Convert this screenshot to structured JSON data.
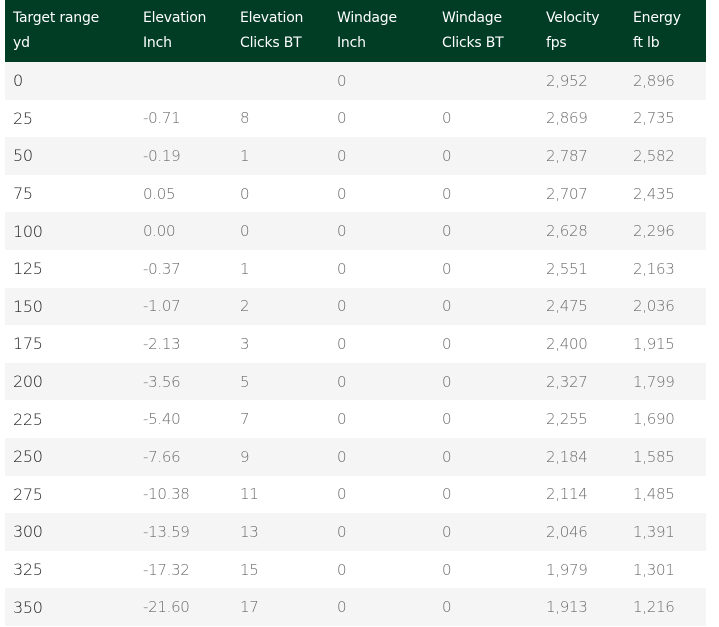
{
  "table": {
    "headers": [
      {
        "line1": "Target range",
        "line2": "yd"
      },
      {
        "line1": "Elevation",
        "line2": "Inch"
      },
      {
        "line1": "Elevation",
        "line2": "Clicks BT"
      },
      {
        "line1": "Windage",
        "line2": "Inch"
      },
      {
        "line1": "Windage",
        "line2": "Clicks BT"
      },
      {
        "line1": "Velocity",
        "line2": "fps"
      },
      {
        "line1": "Energy",
        "line2": "ft lb"
      }
    ],
    "rows": [
      [
        "0",
        "",
        "",
        "0",
        "",
        "2,952",
        "2,896"
      ],
      [
        "25",
        "-0.71",
        "8",
        "0",
        "0",
        "2,869",
        "2,735"
      ],
      [
        "50",
        "-0.19",
        "1",
        "0",
        "0",
        "2,787",
        "2,582"
      ],
      [
        "75",
        "0.05",
        "0",
        "0",
        "0",
        "2,707",
        "2,435"
      ],
      [
        "100",
        "0.00",
        "0",
        "0",
        "0",
        "2,628",
        "2,296"
      ],
      [
        "125",
        "-0.37",
        "1",
        "0",
        "0",
        "2,551",
        "2,163"
      ],
      [
        "150",
        "-1.07",
        "2",
        "0",
        "0",
        "2,475",
        "2,036"
      ],
      [
        "175",
        "-2.13",
        "3",
        "0",
        "0",
        "2,400",
        "1,915"
      ],
      [
        "200",
        "-3.56",
        "5",
        "0",
        "0",
        "2,327",
        "1,799"
      ],
      [
        "225",
        "-5.40",
        "7",
        "0",
        "0",
        "2,255",
        "1,690"
      ],
      [
        "250",
        "-7.66",
        "9",
        "0",
        "0",
        "2,184",
        "1,585"
      ],
      [
        "275",
        "-10.38",
        "11",
        "0",
        "0",
        "2,114",
        "1,485"
      ],
      [
        "300",
        "-13.59",
        "13",
        "0",
        "0",
        "2,046",
        "1,391"
      ],
      [
        "325",
        "-17.32",
        "15",
        "0",
        "0",
        "1,979",
        "1,301"
      ],
      [
        "350",
        "-21.60",
        "17",
        "0",
        "0",
        "1,913",
        "1,216"
      ]
    ]
  },
  "colors": {
    "header_bg": "#003d24",
    "header_text": "#ffffff",
    "row_stripe": "#f4f5f4",
    "cell_text": "#6b6b6b",
    "range_text": "#1f1f1f"
  }
}
